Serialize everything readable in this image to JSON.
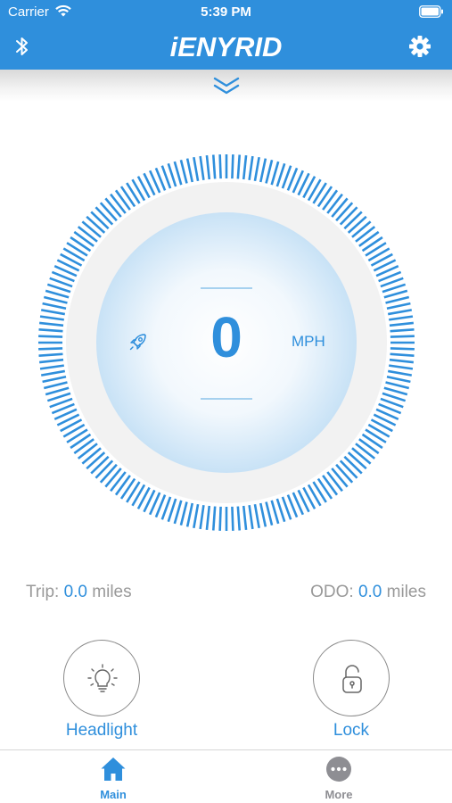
{
  "status_bar": {
    "carrier": "Carrier",
    "time": "5:39 PM"
  },
  "nav": {
    "title": "iENYRID",
    "left_icon": "bluetooth-icon",
    "right_icon": "gear-icon"
  },
  "pull_indicator": "chevron-double-down-icon",
  "speedometer": {
    "speed": "0",
    "unit": "MPH",
    "mode_icon": "rocket-icon"
  },
  "stats": {
    "trip_label": "Trip:",
    "trip_value": "0.0",
    "trip_unit": "miles",
    "odo_label": "ODO:",
    "odo_value": "0.0",
    "odo_unit": "miles"
  },
  "controls": {
    "headlight_label": "Headlight",
    "headlight_icon": "lightbulb-icon",
    "lock_label": "Lock",
    "lock_icon": "lock-icon"
  },
  "tabs": [
    {
      "label": "Main",
      "icon": "home-icon",
      "active": true
    },
    {
      "label": "More",
      "icon": "more-icon",
      "active": false
    }
  ],
  "colors": {
    "accent": "#2f8fdc",
    "muted_text": "#999999"
  }
}
